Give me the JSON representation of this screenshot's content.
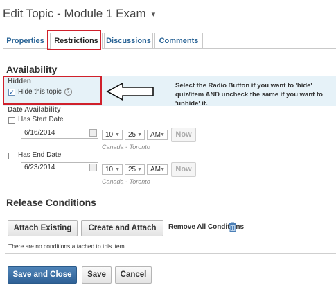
{
  "page": {
    "title": "Edit Topic - Module 1 Exam",
    "title_caret": "▾"
  },
  "tabs": [
    {
      "label": "Properties"
    },
    {
      "label": "Restrictions"
    },
    {
      "label": "Discussions"
    },
    {
      "label": "Comments"
    }
  ],
  "availability": {
    "heading": "Availability",
    "hidden_label": "Hidden",
    "hide_topic_label": "Hide this topic",
    "hide_topic_checked": true,
    "help_glyph": "?"
  },
  "annotation": {
    "text": "Select the Radio Button if you want to 'hide' quiz/item AND uncheck the same if you want to 'unhide' it."
  },
  "date_availability": {
    "heading": "Date Availability",
    "start": {
      "label": "Has Start Date",
      "date": "6/16/2014",
      "hour": "10",
      "minute": "25",
      "ampm": "AM",
      "now_label": "Now",
      "timezone": "Canada - Toronto"
    },
    "end": {
      "label": "Has End Date",
      "date": "6/23/2014",
      "hour": "10",
      "minute": "25",
      "ampm": "AM",
      "now_label": "Now",
      "timezone": "Canada - Toronto"
    }
  },
  "release_conditions": {
    "heading": "Release Conditions",
    "attach_existing_label": "Attach Existing",
    "create_attach_label": "Create and Attach",
    "remove_all_label": "Remove All Conditions",
    "empty_text": "There are no conditions attached to this item."
  },
  "footer": {
    "save_close_label": "Save and Close",
    "save_label": "Save",
    "cancel_label": "Cancel"
  },
  "colors": {
    "highlight": "#d0202b",
    "primary": "#2f6196",
    "link": "#2a6496"
  },
  "icons": [
    "chevron-down-icon",
    "help-icon",
    "arrow-left-icon",
    "trash-icon",
    "calendar-icon",
    "checkmark-icon"
  ]
}
